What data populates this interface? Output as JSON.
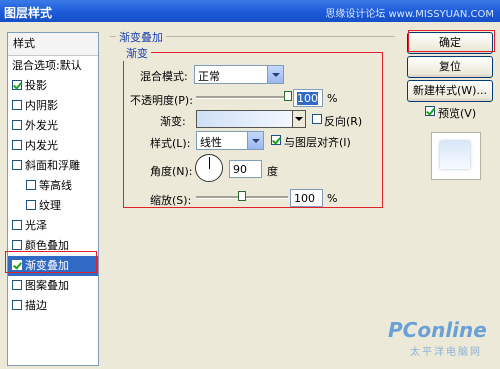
{
  "title": "图层样式",
  "top_watermark": "思缘设计论坛 www.MISSYUAN.COM",
  "sidebar": {
    "header": "样式",
    "blend_options": "混合选项:默认",
    "items": [
      {
        "label": "投影",
        "checked": true
      },
      {
        "label": "内阴影",
        "checked": false
      },
      {
        "label": "外发光",
        "checked": false
      },
      {
        "label": "内发光",
        "checked": false
      },
      {
        "label": "斜面和浮雕",
        "checked": false
      },
      {
        "label": "等高线",
        "checked": false
      },
      {
        "label": "纹理",
        "checked": false
      },
      {
        "label": "光泽",
        "checked": false
      },
      {
        "label": "颜色叠加",
        "checked": false
      },
      {
        "label": "渐变叠加",
        "checked": true,
        "selected": true
      },
      {
        "label": "图案叠加",
        "checked": false
      },
      {
        "label": "描边",
        "checked": false
      }
    ]
  },
  "panel": {
    "group_title": "渐变叠加",
    "sub_title": "渐变",
    "blend_mode_label": "混合模式:",
    "blend_mode_value": "正常",
    "opacity_label": "不透明度(P):",
    "opacity_value": "100",
    "percent": "%",
    "gradient_label": "渐变:",
    "reverse_label": "反向(R)",
    "style_label": "样式(L):",
    "style_value": "线性",
    "align_label": "与图层对齐(I)",
    "angle_label": "角度(N):",
    "angle_value": "90",
    "degree": "度",
    "scale_label": "缩放(S):",
    "scale_value": "100",
    "opacity_level": 1.0,
    "scale_level": 0.5
  },
  "buttons": {
    "ok": "确定",
    "reset": "复位",
    "new_style": "新建样式(W)...",
    "preview": "预览(V)"
  },
  "watermark": {
    "brand": "PConline",
    "sub": "太平洋电脑网"
  }
}
